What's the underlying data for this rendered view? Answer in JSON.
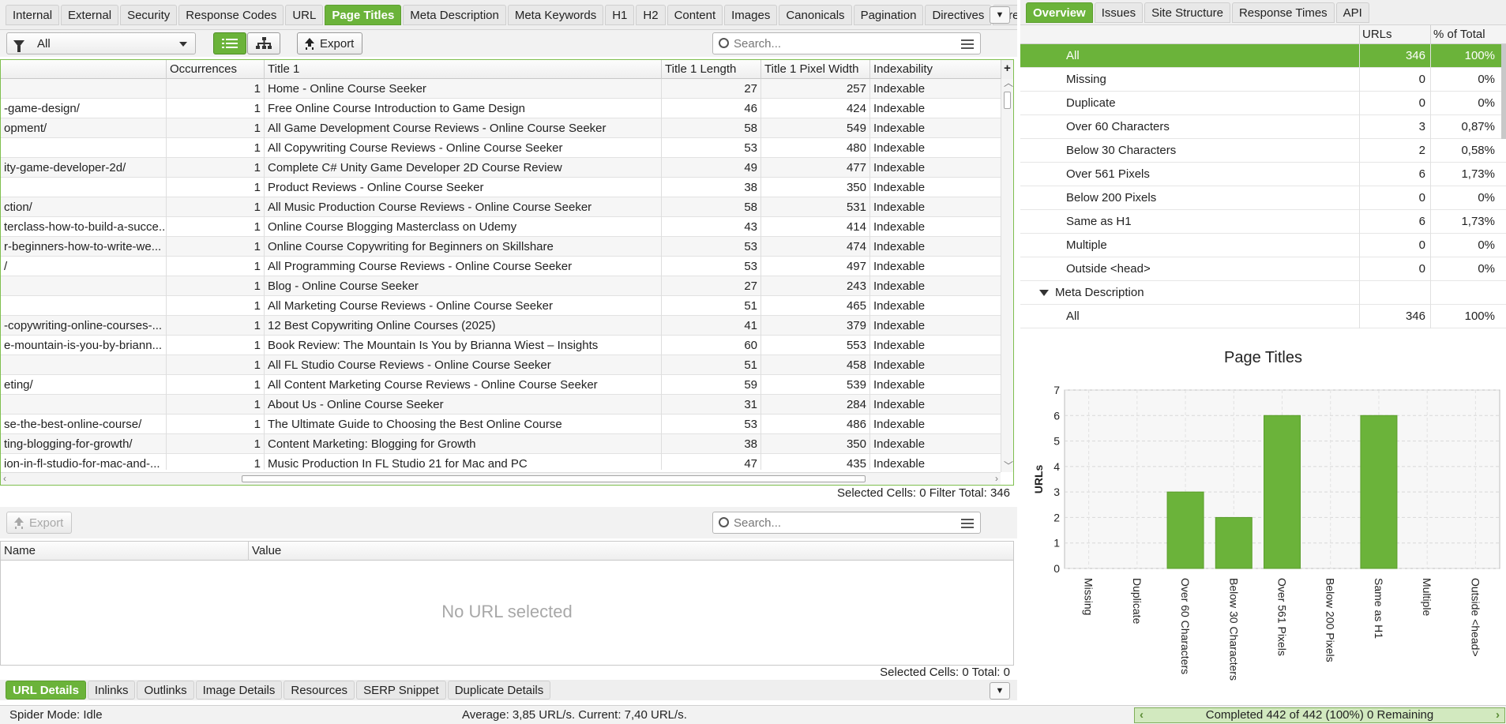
{
  "left_tabs": [
    "Internal",
    "External",
    "Security",
    "Response Codes",
    "URL",
    "Page Titles",
    "Meta Description",
    "Meta Keywords",
    "H1",
    "H2",
    "Content",
    "Images",
    "Canonicals",
    "Pagination",
    "Directives",
    "Hrefl"
  ],
  "left_active_tab": "Page Titles",
  "right_tabs": [
    "Overview",
    "Issues",
    "Site Structure",
    "Response Times",
    "API"
  ],
  "right_active_tab": "Overview",
  "toolbar": {
    "filter_value": "All",
    "export_label": "Export",
    "search_placeholder": "Search..."
  },
  "table": {
    "columns": [
      "",
      "Occurrences",
      "Title 1",
      "Title 1 Length",
      "Title 1 Pixel Width",
      "Indexability"
    ],
    "rows": [
      {
        "address": "",
        "occ": "1",
        "title": "Home - Online Course Seeker",
        "len": "27",
        "px": "257",
        "idx": "Indexable"
      },
      {
        "address": "-game-design/",
        "occ": "1",
        "title": "Free Online Course Introduction to Game Design",
        "len": "46",
        "px": "424",
        "idx": "Indexable"
      },
      {
        "address": "opment/",
        "occ": "1",
        "title": "All Game Development Course Reviews - Online Course Seeker",
        "len": "58",
        "px": "549",
        "idx": "Indexable"
      },
      {
        "address": "",
        "occ": "1",
        "title": "All Copywriting Course Reviews - Online Course Seeker",
        "len": "53",
        "px": "480",
        "idx": "Indexable"
      },
      {
        "address": "ity-game-developer-2d/",
        "occ": "1",
        "title": "Complete C# Unity Game Developer 2D Course Review",
        "len": "49",
        "px": "477",
        "idx": "Indexable"
      },
      {
        "address": "",
        "occ": "1",
        "title": "Product Reviews - Online Course Seeker",
        "len": "38",
        "px": "350",
        "idx": "Indexable"
      },
      {
        "address": "ction/",
        "occ": "1",
        "title": "All Music Production Course Reviews - Online Course Seeker",
        "len": "58",
        "px": "531",
        "idx": "Indexable"
      },
      {
        "address": "terclass-how-to-build-a-succe...",
        "occ": "1",
        "title": "Online Course Blogging Masterclass on Udemy",
        "len": "43",
        "px": "414",
        "idx": "Indexable"
      },
      {
        "address": "r-beginners-how-to-write-we...",
        "occ": "1",
        "title": "Online Course Copywriting for Beginners on Skillshare",
        "len": "53",
        "px": "474",
        "idx": "Indexable"
      },
      {
        "address": "/",
        "occ": "1",
        "title": "All Programming Course Reviews - Online Course Seeker",
        "len": "53",
        "px": "497",
        "idx": "Indexable"
      },
      {
        "address": "",
        "occ": "1",
        "title": "Blog - Online Course Seeker",
        "len": "27",
        "px": "243",
        "idx": "Indexable"
      },
      {
        "address": "",
        "occ": "1",
        "title": "All Marketing Course Reviews - Online Course Seeker",
        "len": "51",
        "px": "465",
        "idx": "Indexable"
      },
      {
        "address": "-copywriting-online-courses-...",
        "occ": "1",
        "title": "12 Best Copywriting Online Courses (2025)",
        "len": "41",
        "px": "379",
        "idx": "Indexable"
      },
      {
        "address": "e-mountain-is-you-by-briann...",
        "occ": "1",
        "title": "Book Review: The Mountain Is You by Brianna Wiest – Insights",
        "len": "60",
        "px": "553",
        "idx": "Indexable"
      },
      {
        "address": "",
        "occ": "1",
        "title": "All FL Studio Course Reviews - Online Course Seeker",
        "len": "51",
        "px": "458",
        "idx": "Indexable"
      },
      {
        "address": "eting/",
        "occ": "1",
        "title": "All Content Marketing Course Reviews - Online Course Seeker",
        "len": "59",
        "px": "539",
        "idx": "Indexable"
      },
      {
        "address": "",
        "occ": "1",
        "title": "About Us - Online Course Seeker",
        "len": "31",
        "px": "284",
        "idx": "Indexable"
      },
      {
        "address": "se-the-best-online-course/",
        "occ": "1",
        "title": "The Ultimate Guide to Choosing the Best Online Course",
        "len": "53",
        "px": "486",
        "idx": "Indexable"
      },
      {
        "address": "ting-blogging-for-growth/",
        "occ": "1",
        "title": "Content Marketing: Blogging for Growth",
        "len": "38",
        "px": "350",
        "idx": "Indexable"
      },
      {
        "address": "ion-in-fl-studio-for-mac-and-...",
        "occ": "1",
        "title": "Music Production In FL Studio 21 for Mac and PC",
        "len": "47",
        "px": "435",
        "idx": "Indexable"
      }
    ]
  },
  "main_status": "Selected Cells:  0  Filter Total:  346",
  "details": {
    "export_label": "Export",
    "search_placeholder": "Search...",
    "columns": [
      "Name",
      "Value"
    ],
    "empty_text": "No URL selected",
    "status": "Selected Cells:  0  Total:  0"
  },
  "bottom_tabs": [
    "URL Details",
    "Inlinks",
    "Outlinks",
    "Image Details",
    "Resources",
    "SERP Snippet",
    "Duplicate Details"
  ],
  "bottom_active_tab": "URL Details",
  "statusbar": {
    "mode": "Spider Mode: Idle",
    "rate": "Average: 3,85 URL/s. Current: 7,40 URL/s.",
    "progress_text": "Completed 442 of 442 (100%) 0 Remaining",
    "progress": 1.0
  },
  "overview": {
    "col_urls": "URLs",
    "col_pct": "% of Total",
    "rows": [
      {
        "label": "All",
        "urls": "346",
        "pct": "100%",
        "selected": true
      },
      {
        "label": "Missing",
        "urls": "0",
        "pct": "0%"
      },
      {
        "label": "Duplicate",
        "urls": "0",
        "pct": "0%"
      },
      {
        "label": "Over 60 Characters",
        "urls": "3",
        "pct": "0,87%"
      },
      {
        "label": "Below 30 Characters",
        "urls": "2",
        "pct": "0,58%"
      },
      {
        "label": "Over 561 Pixels",
        "urls": "6",
        "pct": "1,73%"
      },
      {
        "label": "Below 200 Pixels",
        "urls": "0",
        "pct": "0%"
      },
      {
        "label": "Same as H1",
        "urls": "6",
        "pct": "1,73%"
      },
      {
        "label": "Multiple",
        "urls": "0",
        "pct": "0%"
      },
      {
        "label": "Outside <head>",
        "urls": "0",
        "pct": "0%"
      }
    ],
    "section": "Meta Description",
    "section_rows": [
      {
        "label": "All",
        "urls": "346",
        "pct": "100%"
      }
    ]
  },
  "colors": {
    "accent": "#6bb33a",
    "bar": "#6bb33a"
  },
  "chart_data": {
    "type": "bar",
    "title": "Page Titles",
    "ylabel": "URLs",
    "xlabel": "",
    "categories": [
      "Missing",
      "Duplicate",
      "Over 60 Characters",
      "Below 30 Characters",
      "Over 561 Pixels",
      "Below 200 Pixels",
      "Same as H1",
      "Multiple",
      "Outside <head>"
    ],
    "values": [
      0,
      0,
      3,
      2,
      6,
      0,
      6,
      0,
      0
    ],
    "ylim": [
      0,
      7
    ],
    "yticks": [
      "0",
      "1",
      "2",
      "3",
      "4",
      "5",
      "6",
      "7"
    ],
    "grid": true,
    "legend": "none"
  }
}
